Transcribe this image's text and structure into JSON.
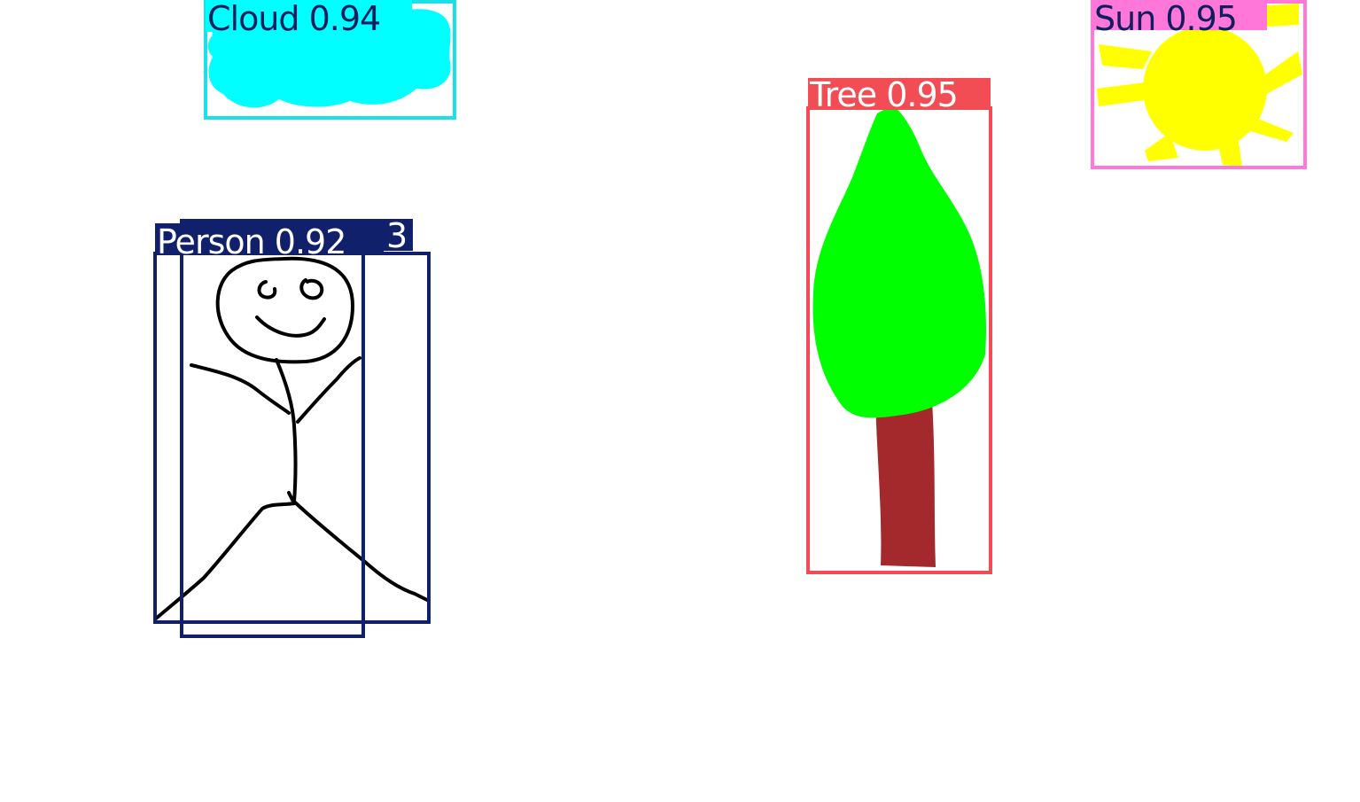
{
  "background_color": "#ffffff",
  "detections": [
    {
      "id": "cloud",
      "label": "Cloud 0.94",
      "box_color": "#1ce0e8",
      "label_bg": "#00ffff",
      "label_text_color": "#0f1e5c",
      "confidence": 0.94
    },
    {
      "id": "tree",
      "label": "Tree 0.95",
      "box_color": "#f24c55",
      "label_bg": "#f24c55",
      "label_text_color": "#ffffff",
      "confidence": 0.95
    },
    {
      "id": "sun",
      "label": "Sun 0.95",
      "box_color": "#ff77d9",
      "label_bg": "#ff77d9",
      "label_text_color": "#0f1e5c",
      "confidence": 0.95
    },
    {
      "id": "person-a",
      "label": "Person 0.92",
      "box_color": "#10206b",
      "label_bg": "#10206b",
      "label_text_color": "#ffffff",
      "confidence": 0.92
    },
    {
      "id": "person-b",
      "label": "3",
      "box_color": "#10206b",
      "label_bg": "#10206b",
      "label_text_color": "#ffffff",
      "confidence": null
    }
  ],
  "drawing_colors": {
    "cloud_fill": "#00ffff",
    "tree_crown": "#00ff00",
    "tree_trunk": "#a3292c",
    "sun_fill": "#ffff00",
    "stick_figure": "#000000"
  }
}
